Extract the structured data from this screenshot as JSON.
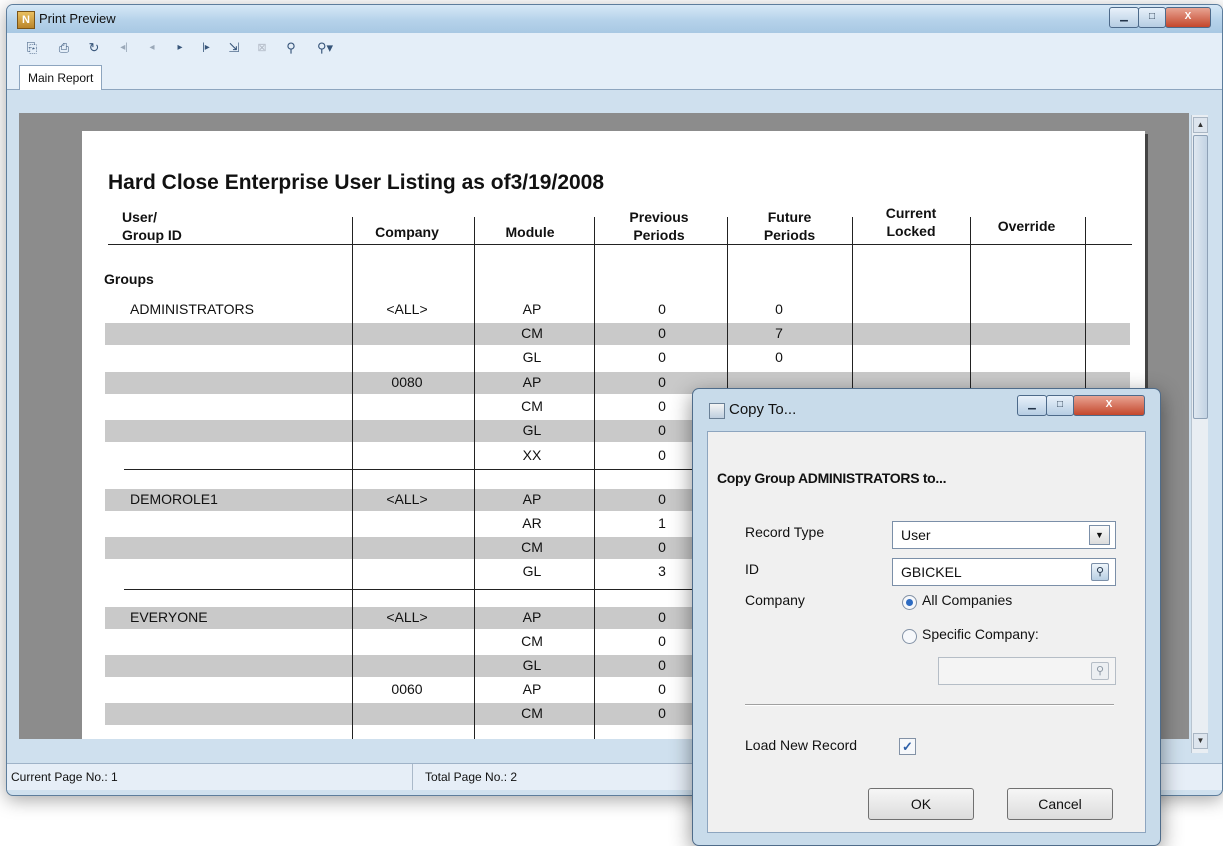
{
  "window": {
    "title": "Print Preview",
    "app_icon": "N"
  },
  "toolbar": {
    "icons": [
      "export-icon",
      "print-icon",
      "refresh-icon",
      "first-page-icon",
      "prev-page-icon",
      "next-page-icon",
      "last-page-icon",
      "goto-page-icon",
      "close-icon",
      "find-icon",
      "zoom-icon"
    ]
  },
  "tabs": {
    "main": "Main Report"
  },
  "status": {
    "current_page": "Current Page No.: 1",
    "total_pages": "Total Page No.: 2"
  },
  "report": {
    "title": "Hard Close Enterprise User Listing as of3/19/2008",
    "columns": {
      "user_line1": "User/",
      "user_line2": "Group ID",
      "company": "Company",
      "module": "Module",
      "previous_line1": "Previous",
      "previous_line2": "Periods",
      "future_line1": "Future",
      "future_line2": "Periods",
      "current_line1": "Current",
      "current_line2": "Locked",
      "override": "Override"
    },
    "section": "Groups",
    "rows": [
      {
        "group": "ADMINISTRATORS",
        "company": "<ALL>",
        "module": "AP",
        "previous": "0",
        "future": "0"
      },
      {
        "group": "",
        "company": "",
        "module": "CM",
        "previous": "0",
        "future": "7"
      },
      {
        "group": "",
        "company": "",
        "module": "GL",
        "previous": "0",
        "future": "0"
      },
      {
        "group": "",
        "company": "0080",
        "module": "AP",
        "previous": "0",
        "future": ""
      },
      {
        "group": "",
        "company": "",
        "module": "CM",
        "previous": "0",
        "future": ""
      },
      {
        "group": "",
        "company": "",
        "module": "GL",
        "previous": "0",
        "future": ""
      },
      {
        "group": "",
        "company": "",
        "module": "XX",
        "previous": "0",
        "future": ""
      },
      {
        "group": "DEMOROLE1",
        "company": "<ALL>",
        "module": "AP",
        "previous": "0",
        "future": ""
      },
      {
        "group": "",
        "company": "",
        "module": "AR",
        "previous": "1",
        "future": ""
      },
      {
        "group": "",
        "company": "",
        "module": "CM",
        "previous": "0",
        "future": ""
      },
      {
        "group": "",
        "company": "",
        "module": "GL",
        "previous": "3",
        "future": ""
      },
      {
        "group": "EVERYONE",
        "company": "<ALL>",
        "module": "AP",
        "previous": "0",
        "future": ""
      },
      {
        "group": "",
        "company": "",
        "module": "CM",
        "previous": "0",
        "future": ""
      },
      {
        "group": "",
        "company": "",
        "module": "GL",
        "previous": "0",
        "future": ""
      },
      {
        "group": "",
        "company": "0060",
        "module": "AP",
        "previous": "0",
        "future": ""
      },
      {
        "group": "",
        "company": "",
        "module": "CM",
        "previous": "0",
        "future": ""
      }
    ]
  },
  "dialog": {
    "title": "Copy To...",
    "heading": "Copy Group ADMINISTRATORS to...",
    "record_type_label": "Record Type",
    "record_type_value": "User",
    "id_label": "ID",
    "id_value": "GBICKEL",
    "company_label": "Company",
    "radio_all": "All Companies",
    "radio_specific": "Specific Company:",
    "specific_value": "",
    "load_label": "Load New Record",
    "load_checked": true,
    "ok": "OK",
    "cancel": "Cancel"
  }
}
